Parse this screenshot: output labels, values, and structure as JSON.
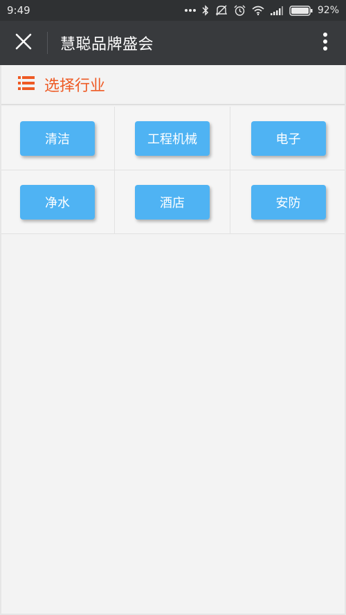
{
  "status_bar": {
    "time": "9:49",
    "battery": "92%",
    "icons": [
      "more-dots-icon",
      "bluetooth-icon",
      "mute-icon",
      "alarm-icon",
      "wifi-icon",
      "signal-icon",
      "battery-icon"
    ]
  },
  "title_bar": {
    "title": "慧聪品牌盛会",
    "close_icon": "close-icon",
    "more_icon": "more-vertical-icon"
  },
  "section": {
    "title": "选择行业",
    "icon": "list-icon",
    "accent_color": "#ee5a24"
  },
  "industries": [
    {
      "label": "清洁"
    },
    {
      "label": "工程机械"
    },
    {
      "label": "电子"
    },
    {
      "label": "净水"
    },
    {
      "label": "酒店"
    },
    {
      "label": "安防"
    }
  ],
  "colors": {
    "button": "#4fb3f3",
    "title_bar": "#383a3d",
    "status_bar": "#2f3133"
  }
}
